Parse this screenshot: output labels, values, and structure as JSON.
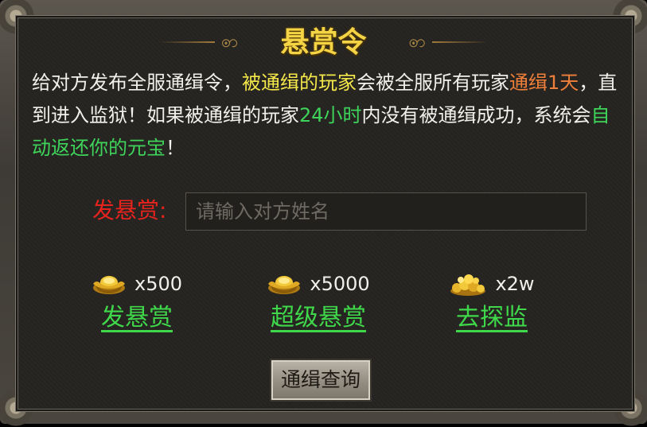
{
  "title": "悬赏令",
  "description": {
    "p1": "给对方发布全服通缉令，",
    "p2": "被通缉的玩家",
    "p3": "会被全服所有玩家",
    "p4": "通缉1天",
    "p5": "，直到进入监狱！如果被通缉的玩家",
    "p6": "24小时",
    "p7": "内没有被通缉成功，系统会",
    "p8": "自动返还你的元宝",
    "p9": "！"
  },
  "bounty": {
    "label": "发悬赏:",
    "placeholder": "请输入对方姓名",
    "value": ""
  },
  "options": [
    {
      "icon": "gold-ingot-icon",
      "cost": "x500",
      "action": "发悬赏"
    },
    {
      "icon": "gold-ingot-icon",
      "cost": "x5000",
      "action": "超级悬赏"
    },
    {
      "icon": "gold-coins-icon",
      "cost": "x2w",
      "action": "去探监"
    }
  ],
  "query_button": "通缉查询",
  "colors": {
    "title": "#f4d445",
    "highlight_yellow": "#f3e74a",
    "highlight_orange": "#ee7f3a",
    "highlight_green": "#3ed45a",
    "label_red": "#e8231d",
    "link_green": "#3fd84a"
  }
}
